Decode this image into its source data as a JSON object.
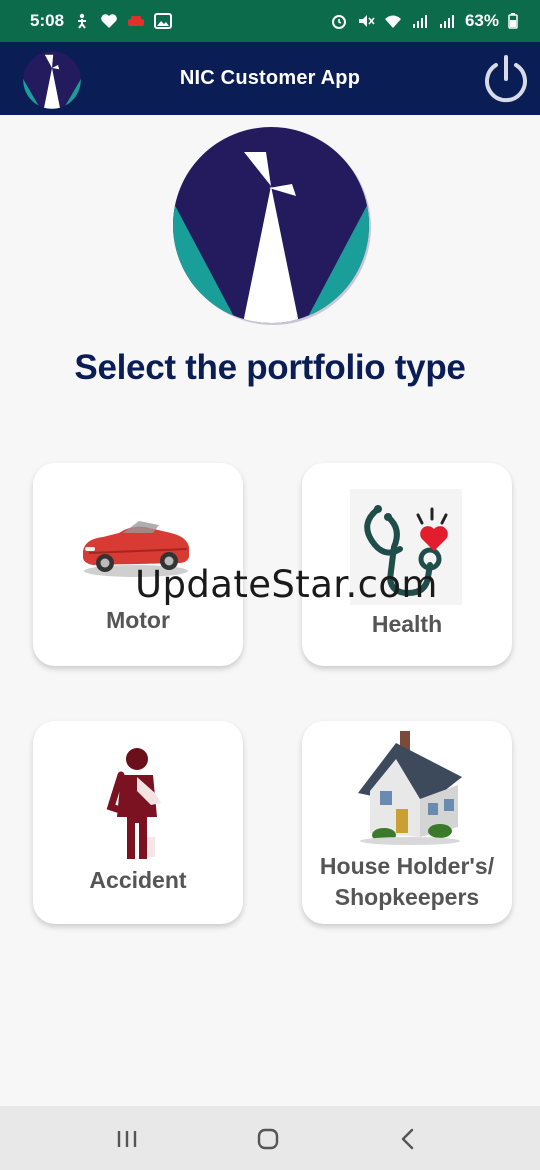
{
  "status_bar": {
    "time": "5:08",
    "battery": "63%",
    "left_icons": [
      "fitness-icon",
      "heart-icon",
      "car-icon",
      "image-icon"
    ],
    "right_icons": [
      "alarm-icon",
      "mute-icon",
      "wifi-icon",
      "signal-icon",
      "signal-icon-2",
      "battery-icon"
    ]
  },
  "app_bar": {
    "title": "NIC Customer App",
    "logo_icon": "nic-logo-icon",
    "power_icon": "power-icon"
  },
  "main": {
    "title": "Select the portfolio type",
    "cards": [
      {
        "label": "Motor",
        "icon": "car-icon"
      },
      {
        "label": "Health",
        "icon": "stethoscope-heart-icon"
      },
      {
        "label": "Accident",
        "icon": "injured-person-icon"
      },
      {
        "label_line1": "House Holder's/",
        "label_line2": "Shopkeepers",
        "icon": "house-icon"
      }
    ]
  },
  "watermark": "UpdateStar.com",
  "colors": {
    "status_bar": "#0b6b4a",
    "app_bar": "#0b1d55",
    "title": "#0b1d55",
    "logo_teal": "#1a9e9a",
    "logo_navy": "#241a5e",
    "card_label": "#555555"
  },
  "nav_bar": {
    "icons": [
      "recent-apps-icon",
      "home-icon",
      "back-icon"
    ]
  }
}
